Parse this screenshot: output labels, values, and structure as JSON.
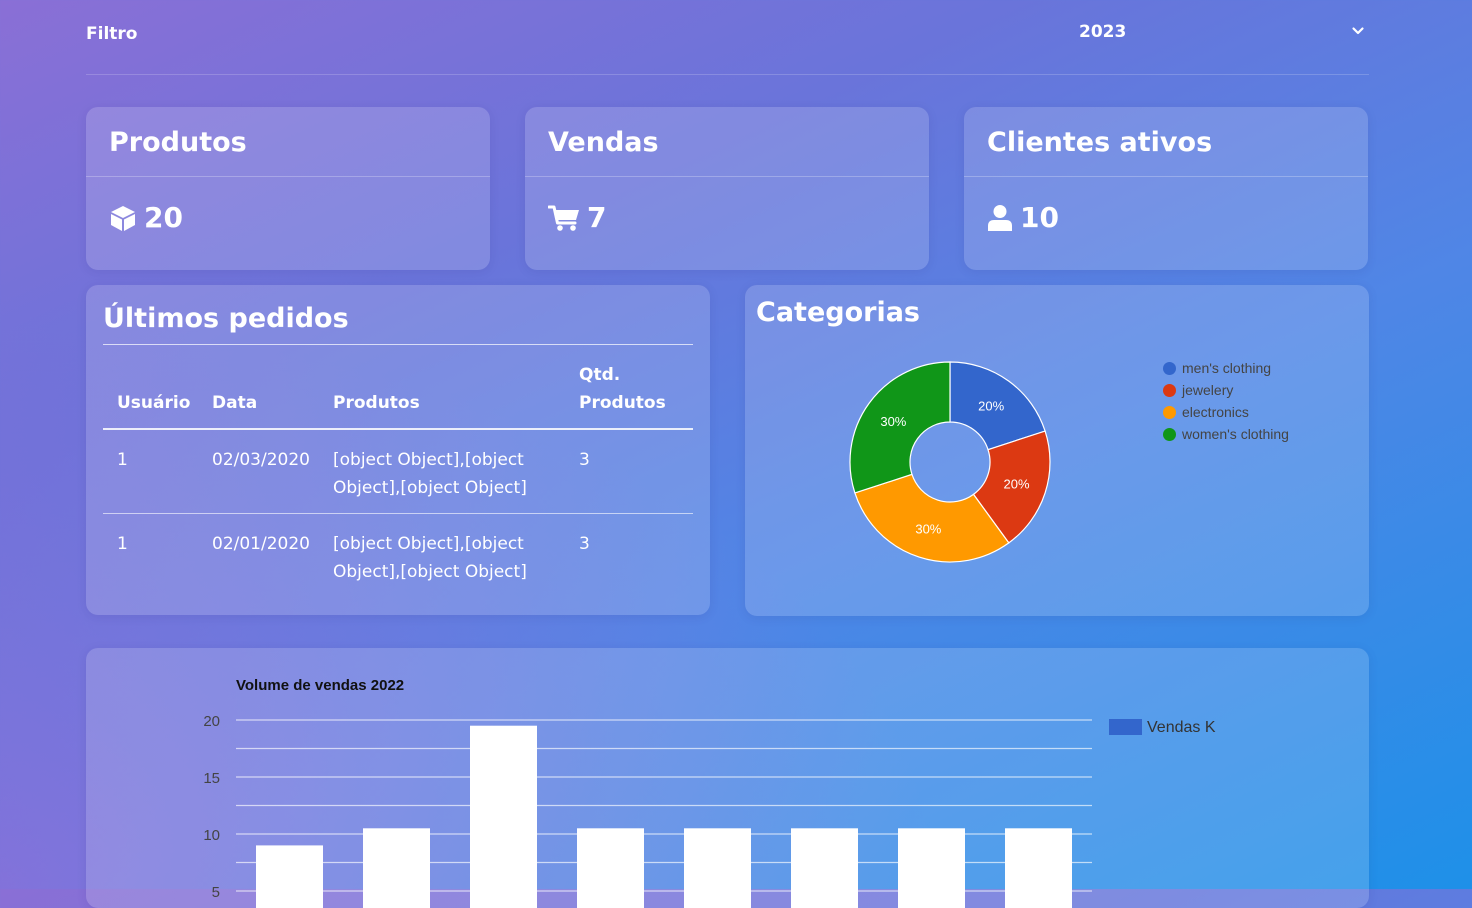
{
  "header": {
    "filter_label": "Filtro",
    "year": "2023"
  },
  "stats": [
    {
      "title": "Produtos",
      "icon": "box-icon",
      "value": "20"
    },
    {
      "title": "Vendas",
      "icon": "cart-icon",
      "value": "7"
    },
    {
      "title": "Clientes ativos",
      "icon": "user-icon",
      "value": "10"
    }
  ],
  "orders": {
    "title": "Últimos pedidos",
    "columns": [
      "Usuário",
      "Data",
      "Produtos",
      "Qtd.",
      "Produtos"
    ],
    "rows": [
      {
        "user": "1",
        "date": "02/03/2020",
        "products_line1": "[object Object],[object",
        "products_line2": "Object],[object Object]",
        "qty": "3"
      },
      {
        "user": "1",
        "date": "02/01/2020",
        "products_line1": "[object Object],[object",
        "products_line2": "Object],[object Object]",
        "qty": "3"
      }
    ]
  },
  "categories": {
    "title": "Categorias",
    "chart_data": {
      "type": "pie",
      "labels": [
        "men's clothing",
        "jewelery",
        "electronics",
        "women's clothing"
      ],
      "values": [
        20,
        20,
        30,
        30
      ],
      "value_labels": [
        "20%",
        "20%",
        "30%",
        "30%"
      ],
      "colors": [
        "#3366cc",
        "#dc3912",
        "#ff9900",
        "#109618"
      ],
      "donut": true,
      "legend": "right"
    }
  },
  "sales_chart": {
    "chart_data": {
      "type": "bar",
      "title": "Volume de vendas 2022",
      "categories": [
        "",
        "",
        "",
        "",
        "",
        "",
        "",
        ""
      ],
      "series": [
        {
          "name": "Vendas K",
          "values": [
            9,
            10.5,
            19.5,
            10.5,
            10.5,
            10.5,
            10.5,
            10.5
          ]
        }
      ],
      "ylim": [
        0,
        20
      ],
      "yticks": [
        "20",
        "15",
        "10",
        "5"
      ],
      "grid": true,
      "legend": "right",
      "bar_color": "#ffffff",
      "legend_color": "#3366cc"
    }
  }
}
